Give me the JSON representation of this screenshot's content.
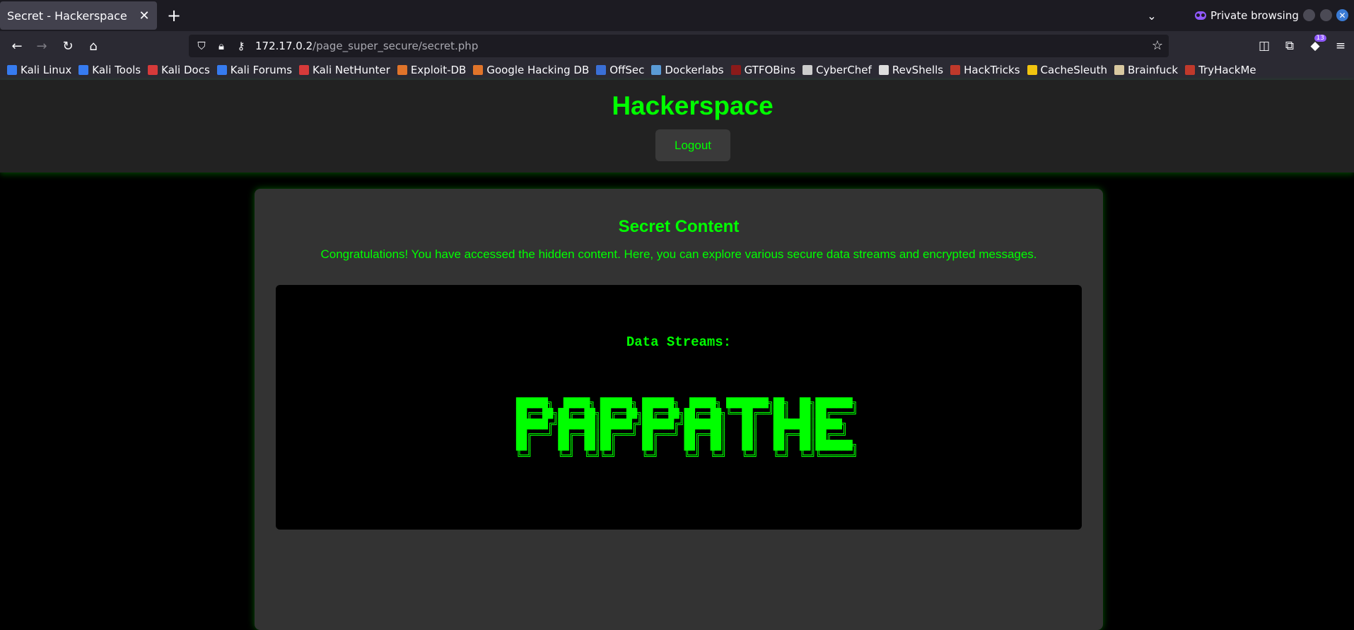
{
  "browser": {
    "tab_title": "Secret - Hackerspace",
    "tab_close": "✕",
    "new_tab": "+",
    "private_label": "Private browsing",
    "url_host": "172.17.0.2",
    "url_path": "/page_super_secure/secret.php",
    "extensions_badge": "13",
    "bookmarks": [
      {
        "label": "Kali Linux",
        "color": "#367bf0"
      },
      {
        "label": "Kali Tools",
        "color": "#367bf0"
      },
      {
        "label": "Kali Docs",
        "color": "#d63a3a"
      },
      {
        "label": "Kali Forums",
        "color": "#367bf0"
      },
      {
        "label": "Kali NetHunter",
        "color": "#d63a3a"
      },
      {
        "label": "Exploit-DB",
        "color": "#e0742a"
      },
      {
        "label": "Google Hacking DB",
        "color": "#e0742a"
      },
      {
        "label": "OffSec",
        "color": "#3a6fd6"
      },
      {
        "label": "Dockerlabs",
        "color": "#5a9bd6"
      },
      {
        "label": "GTFOBins",
        "color": "#8b1a1a"
      },
      {
        "label": "CyberChef",
        "color": "#cccccc"
      },
      {
        "label": "RevShells",
        "color": "#dddddd"
      },
      {
        "label": "HackTricks",
        "color": "#c0392b"
      },
      {
        "label": "CacheSleuth",
        "color": "#f1c40f"
      },
      {
        "label": "Brainfuck",
        "color": "#d8c8a0"
      },
      {
        "label": "TryHackMe",
        "color": "#c0392b"
      }
    ]
  },
  "site": {
    "title": "Hackerspace",
    "logout_label": "Logout"
  },
  "secret": {
    "heading": "Secret Content",
    "message": "Congratulations! You have accessed the hidden content. Here, you can explore various secure data streams and encrypted messages.",
    "streams_label": "Data Streams:",
    "ascii_art": "██████╗  █████╗ ██████╗ ██████╗  █████╗ ████████╗██╗  ██╗███████╗\n██╔══██╗██╔══██╗██╔══██╗██╔══██╗██╔══██╗╚══██╔══╝██║  ██║██╔════╝\n██████╔╝███████║██████╔╝██████╔╝███████║   ██║   ███████║█████╗  \n██╔═══╝ ██╔══██║██╔═══╝ ██╔═══╝ ██╔══██║   ██║   ██╔══██║██╔══╝  \n██║     ██║  ██║██║     ██║     ██║  ██║   ██║   ██║  ██║███████╗\n╚═╝     ╚═╝  ╚═╝╚═╝     ╚═╝     ╚═╝  ╚═╝   ╚═╝   ╚═╝  ╚═╝╚══════╝"
  },
  "colors": {
    "accent": "#00ff00",
    "header_bg": "#222222",
    "card_bg": "#333333"
  }
}
